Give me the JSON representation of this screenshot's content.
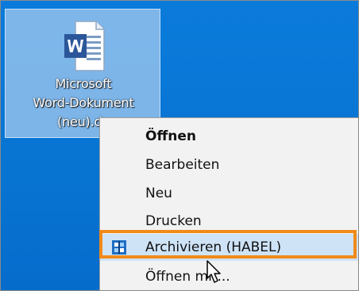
{
  "desktop": {
    "file_icon": {
      "icon": "word-document-icon",
      "caption_lines": [
        "Microsoft",
        "Word-Dokument",
        "(neu).do"
      ]
    }
  },
  "context_menu": {
    "items": [
      {
        "label": "Öffnen",
        "bold": true
      },
      {
        "label": "Bearbeiten"
      },
      {
        "label": "Neu"
      },
      {
        "label": "Drucken"
      },
      {
        "label": "Archivieren (HABEL)",
        "icon": "archive-icon",
        "highlighted": true
      },
      {
        "label": "Öffnen mit..."
      }
    ]
  },
  "colors": {
    "desktop": "#0a78d7",
    "selection": "#aacdf0",
    "menu_bg": "#f2f2f2",
    "menu_highlight": "#cfe3f7",
    "focus_box": "#f08a1a",
    "word_blue": "#2b579a"
  },
  "cursor": "arrow-cursor"
}
